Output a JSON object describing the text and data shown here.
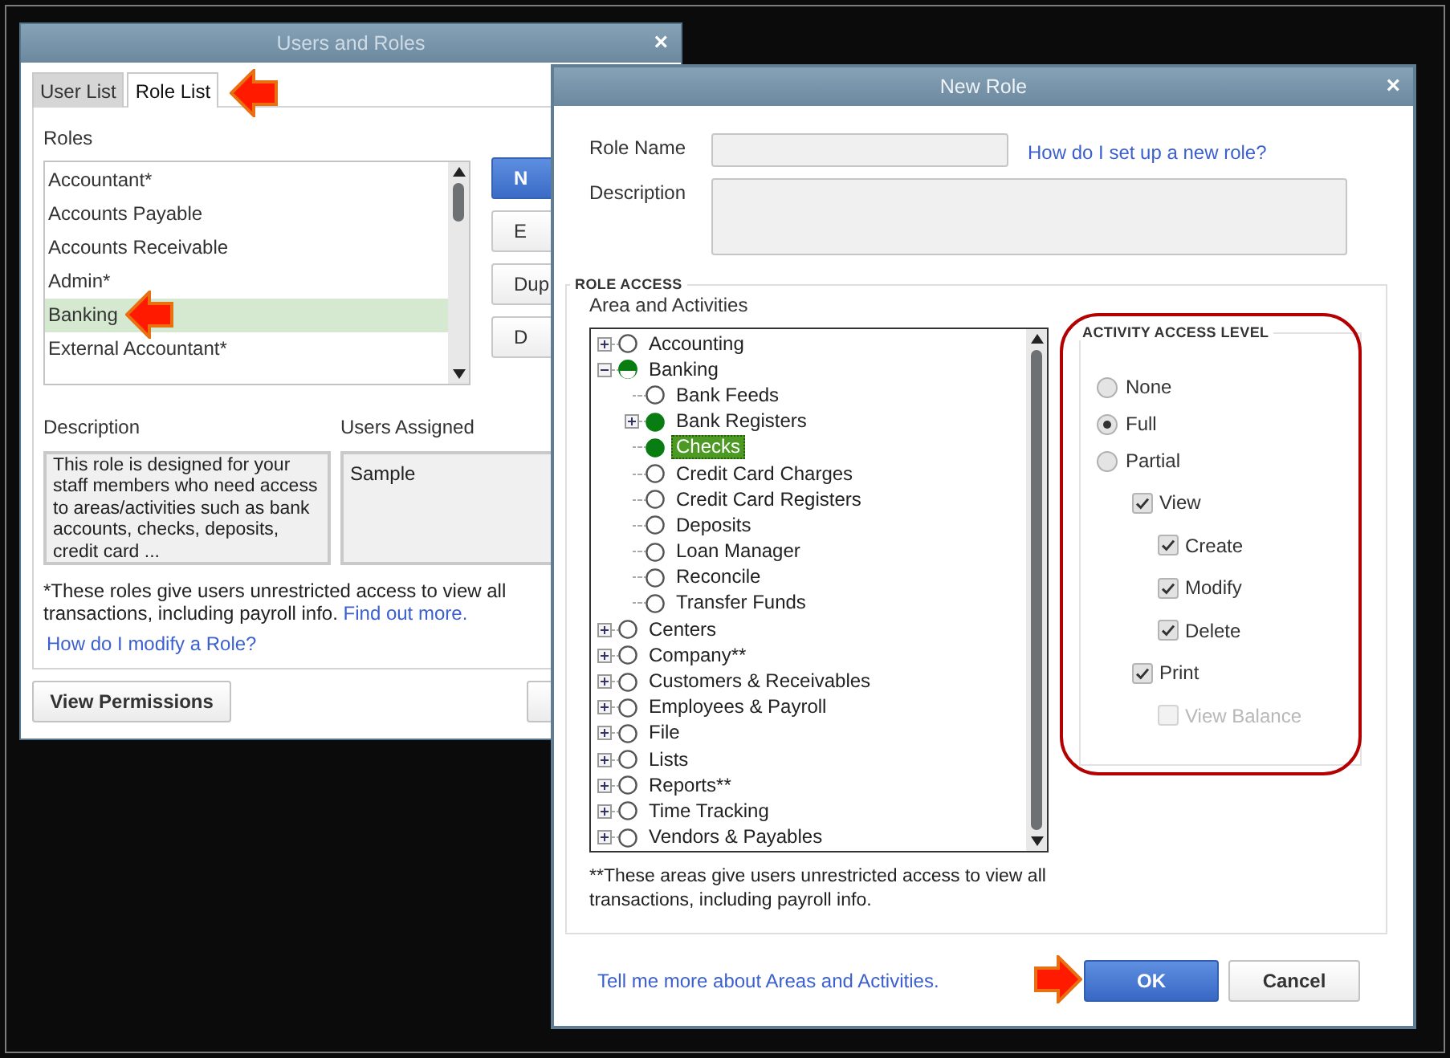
{
  "users_and_roles": {
    "title": "Users and Roles",
    "close": "×",
    "tabs": [
      {
        "label": "User List",
        "selected": false
      },
      {
        "label": "Role List",
        "selected": true
      }
    ],
    "roles_label": "Roles",
    "roles": [
      {
        "name": "Accountant*",
        "selected": false
      },
      {
        "name": "Accounts Payable",
        "selected": false
      },
      {
        "name": "Accounts Receivable",
        "selected": false
      },
      {
        "name": "Admin*",
        "selected": false
      },
      {
        "name": "Banking",
        "selected": true
      },
      {
        "name": "External Accountant*",
        "selected": false
      }
    ],
    "side_buttons": [
      {
        "label": "N",
        "primary": true
      },
      {
        "label": "E",
        "primary": false
      },
      {
        "label": "Dup",
        "primary": false
      },
      {
        "label": "D",
        "primary": false
      }
    ],
    "description_label": "Description",
    "description": "This role is designed for your staff members who need access to areas/activities such as bank accounts, checks, deposits, credit card ...",
    "users_assigned_label": "Users Assigned",
    "users_assigned": [
      "Sample"
    ],
    "footnote": "*These roles give users unrestricted access to view all transactions, including payroll info.",
    "footnote_link": "Find out more.",
    "help_link": "How do I modify a Role?",
    "view_permissions_button": "View Permissions"
  },
  "new_role": {
    "title": "New Role",
    "close": "×",
    "role_name_label": "Role Name",
    "setup_link": "How do I set up a new role?",
    "description_label": "Description",
    "role_access_label": "ROLE ACCESS",
    "areas_label": "Area and Activities",
    "areas": [
      {
        "label": "Accounting",
        "checked": false,
        "partial": false,
        "expanded": false,
        "selected": false
      },
      {
        "label": "Banking",
        "checked": false,
        "partial": true,
        "expanded": true,
        "selected": false,
        "children": [
          {
            "label": "Bank Feeds",
            "checked": false,
            "partial": false,
            "selected": false
          },
          {
            "label": "Bank Registers",
            "checked": true,
            "partial": false,
            "expanded": false,
            "selected": false
          },
          {
            "label": "Checks",
            "checked": true,
            "partial": false,
            "selected": true
          },
          {
            "label": "Credit Card Charges",
            "checked": false,
            "partial": false,
            "selected": false
          },
          {
            "label": "Credit Card Registers",
            "checked": false,
            "partial": false,
            "selected": false
          },
          {
            "label": "Deposits",
            "checked": false,
            "partial": false,
            "selected": false
          },
          {
            "label": "Loan Manager",
            "checked": false,
            "partial": false,
            "selected": false
          },
          {
            "label": "Reconcile",
            "checked": false,
            "partial": false,
            "selected": false
          },
          {
            "label": "Transfer Funds",
            "checked": false,
            "partial": false,
            "selected": false
          }
        ]
      },
      {
        "label": "Centers",
        "checked": false,
        "partial": false,
        "expanded": false,
        "selected": false
      },
      {
        "label": "Company**",
        "checked": false,
        "partial": false,
        "expanded": false,
        "selected": false
      },
      {
        "label": "Customers & Receivables",
        "checked": false,
        "partial": false,
        "expanded": false,
        "selected": false
      },
      {
        "label": "Employees & Payroll",
        "checked": false,
        "partial": false,
        "expanded": false,
        "selected": false
      },
      {
        "label": "File",
        "checked": false,
        "partial": false,
        "expanded": false,
        "selected": false
      },
      {
        "label": "Lists",
        "checked": false,
        "partial": false,
        "expanded": false,
        "selected": false
      },
      {
        "label": "Reports**",
        "checked": false,
        "partial": false,
        "expanded": false,
        "selected": false
      },
      {
        "label": "Time Tracking",
        "checked": false,
        "partial": false,
        "expanded": false,
        "selected": false
      },
      {
        "label": "Vendors & Payables",
        "checked": false,
        "partial": false,
        "expanded": false,
        "selected": false
      }
    ],
    "areas_footnote": "**These areas give users unrestricted access to view all transactions, including payroll info.",
    "activity_label": "ACTIVITY ACCESS LEVEL",
    "levels": [
      {
        "label": "None",
        "selected": false
      },
      {
        "label": "Full",
        "selected": true
      },
      {
        "label": "Partial",
        "selected": false
      }
    ],
    "permissions": [
      {
        "label": "View",
        "checked": true,
        "disabled": false,
        "children": [
          {
            "label": "Create",
            "checked": true,
            "disabled": false
          },
          {
            "label": "Modify",
            "checked": true,
            "disabled": false
          },
          {
            "label": "Delete",
            "checked": true,
            "disabled": false
          }
        ]
      },
      {
        "label": "Print",
        "checked": true,
        "disabled": false,
        "children": [
          {
            "label": "View Balance",
            "checked": false,
            "disabled": true
          }
        ]
      }
    ],
    "more_link": "Tell me more about Areas and Activities.",
    "ok_button": "OK",
    "cancel_button": "Cancel"
  }
}
